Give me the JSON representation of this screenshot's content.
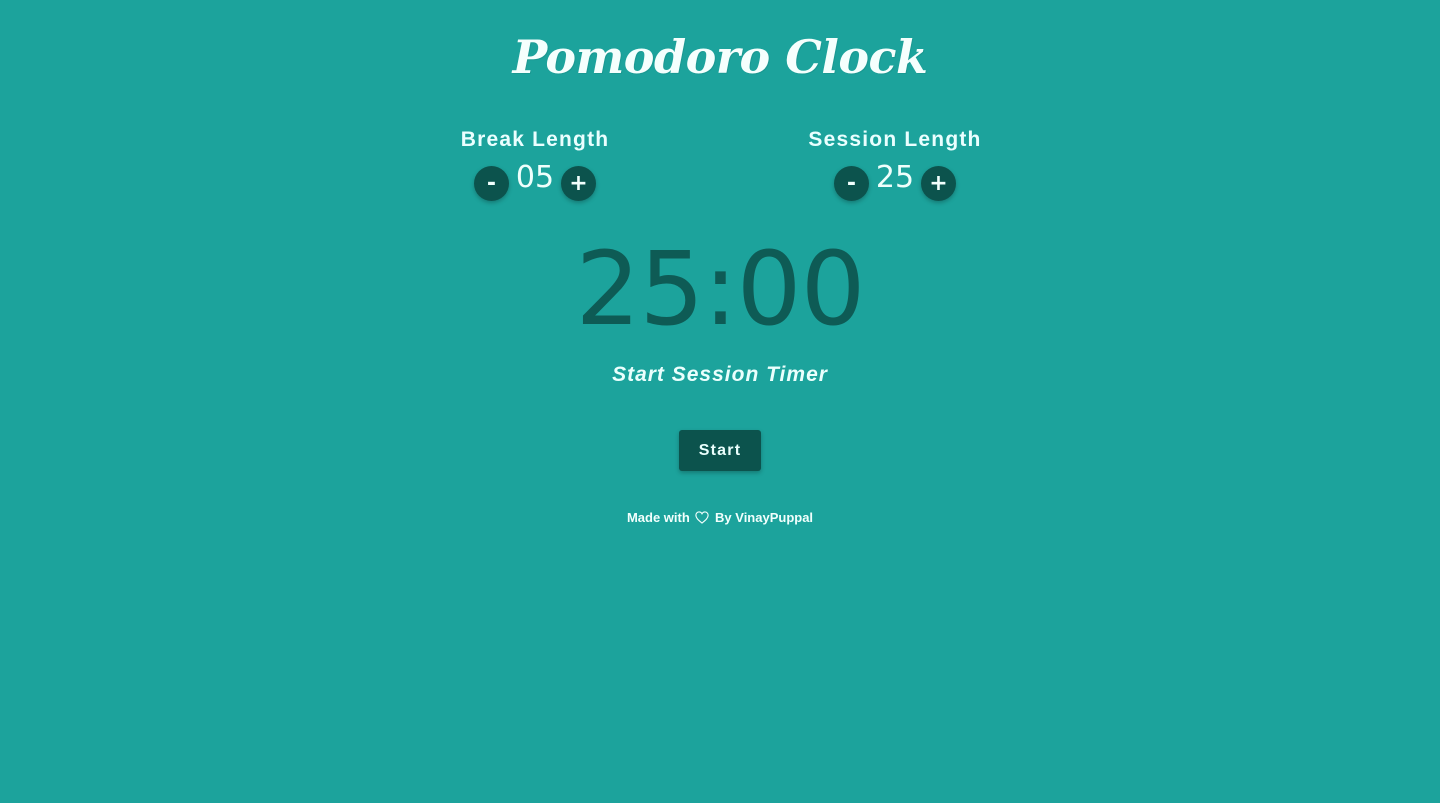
{
  "app": {
    "title": "Pomodoro Clock"
  },
  "break": {
    "label": "Break Length",
    "value": "05",
    "decrement_label": "-",
    "increment_label": "+"
  },
  "session": {
    "label": "Session Length",
    "value": "25",
    "decrement_label": "-",
    "increment_label": "+"
  },
  "timer": {
    "display": "25:00",
    "status": "Start Session Timer"
  },
  "controls": {
    "start_label": "Start"
  },
  "footer": {
    "prefix": "Made with",
    "icon": "heart-outline-icon",
    "suffix": "By VinayPuppal"
  },
  "colors": {
    "background": "#1ca39c",
    "button_dark": "#0c534d",
    "timer_text": "#0e5b55",
    "light_text": "#eafffd"
  }
}
